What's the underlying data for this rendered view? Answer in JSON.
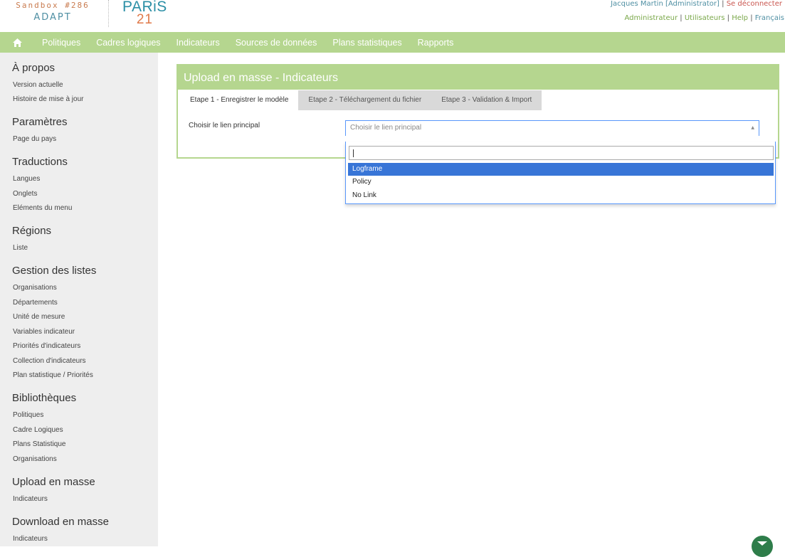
{
  "header": {
    "sandbox": "Sandbox #286",
    "adapt": "ADAPT",
    "paris_top": "PARiS",
    "paris_bottom": "21",
    "user": "Jacques Martin [Administrator]",
    "logout": "Se déconnecter",
    "admin_links": [
      "Administrateur",
      "Utilisateurs",
      "Help",
      "Français"
    ]
  },
  "nav": {
    "home_icon": "home-icon",
    "items": [
      "Politiques",
      "Cadres logiques",
      "Indicateurs",
      "Sources de données",
      "Plans statistiques",
      "Rapports"
    ]
  },
  "sidebar": {
    "sections": [
      {
        "title": "À propos",
        "links": [
          "Version actuelle",
          "Histoire de mise à jour"
        ]
      },
      {
        "title": "Paramètres",
        "links": [
          "Page du pays"
        ]
      },
      {
        "title": "Traductions",
        "links": [
          "Langues",
          "Onglets",
          "Eléments du menu"
        ]
      },
      {
        "title": "Régions",
        "links": [
          "Liste"
        ]
      },
      {
        "title": "Gestion des listes",
        "links": [
          "Organisations",
          "Départements",
          "Unité de mesure",
          "Variables indicateur",
          "Priorités d'indicateurs",
          "Collection d'indicateurs",
          "Plan statistique / Priorités"
        ]
      },
      {
        "title": "Bibliothèques",
        "links": [
          "Politiques",
          "Cadre Logiques",
          "Plans Statistique",
          "Organisations"
        ]
      },
      {
        "title": "Upload en masse",
        "links": [
          "Indicateurs"
        ]
      },
      {
        "title": "Download en masse",
        "links": [
          "Indicateurs"
        ]
      }
    ]
  },
  "main": {
    "title": "Upload en masse - Indicateurs",
    "tabs": [
      "Etape  1 - Enregistrer le modèle",
      "Etape  2 - Téléchargement du fichier",
      "Etape  3 - Validation & Import"
    ],
    "field_label": "Choisir le lien principal",
    "select_placeholder": "Choisir le lien principal",
    "options": [
      "Logframe",
      "Policy",
      "No Link"
    ],
    "highlighted_option": "Logframe"
  },
  "colors": {
    "nav_green": "#b5d68f",
    "highlight_blue": "#3875d7",
    "link_blue": "#4f8fa3",
    "logout_red": "#c9564f"
  }
}
